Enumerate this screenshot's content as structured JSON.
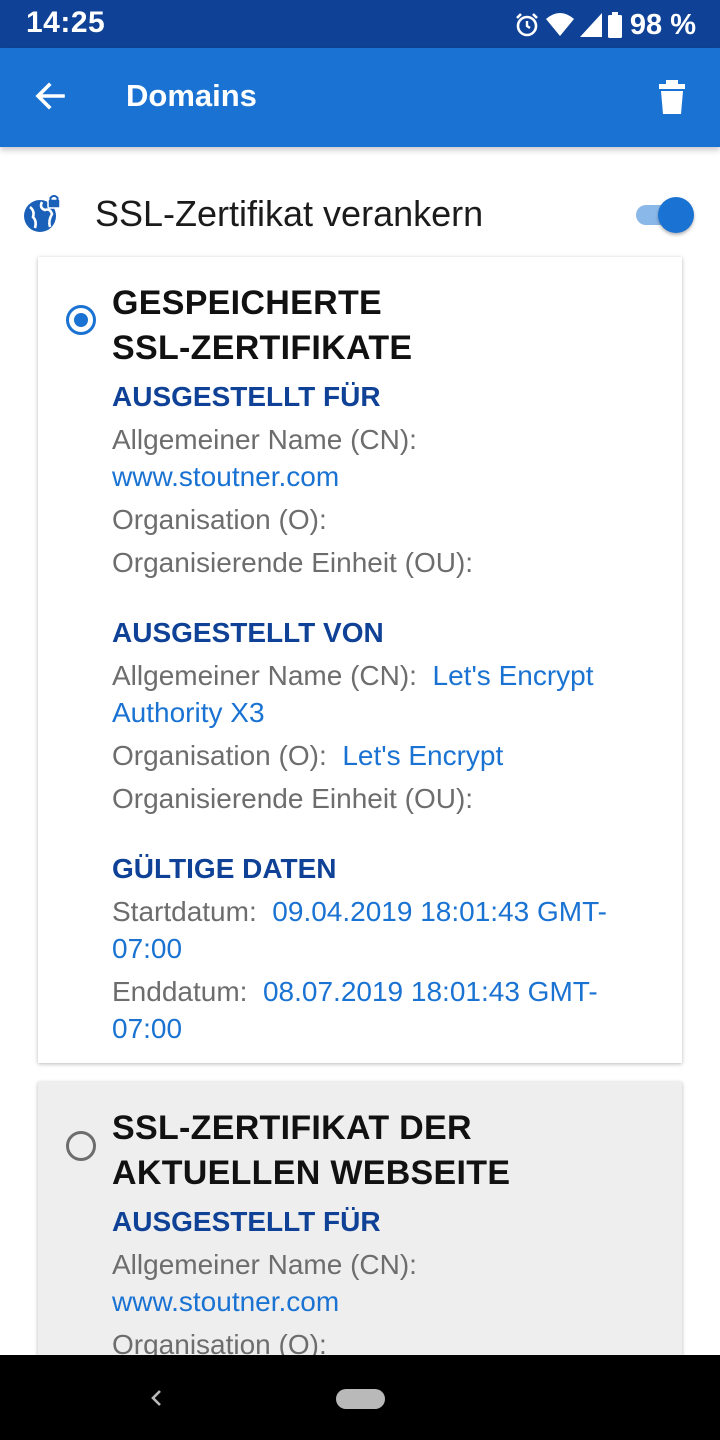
{
  "status_bar": {
    "time": "14:25",
    "battery": "98 %",
    "icons": [
      "alarm-icon",
      "wifi-icon",
      "cell-signal-icon",
      "battery-icon"
    ]
  },
  "app_bar": {
    "title": "Domains",
    "back_icon": "arrow-back-icon",
    "delete_icon": "trash-icon"
  },
  "pin": {
    "label": "SSL-Zertifikat verankern",
    "icon": "globe-lock-icon",
    "enabled": true
  },
  "stored_cert": {
    "selected": true,
    "title_line1": "GESPEICHERTE",
    "title_line2": "SSL-ZERTIFIKATE",
    "issued_to": {
      "heading": "AUSGESTELLT FÜR",
      "cn_label": "Allgemeiner Name (CN):",
      "cn_value": "www.stoutner.com",
      "o_label": "Organisation (O):",
      "o_value": "",
      "ou_label": "Organisierende Einheit (OU):",
      "ou_value": ""
    },
    "issued_by": {
      "heading": "AUSGESTELLT VON",
      "cn_label": "Allgemeiner Name (CN):",
      "cn_value": "Let's Encrypt Authority X3",
      "o_label": "Organisation (O):",
      "o_value": "Let's Encrypt",
      "ou_label": "Organisierende Einheit (OU):",
      "ou_value": ""
    },
    "valid": {
      "heading": "GÜLTIGE DATEN",
      "start_label": "Startdatum:",
      "start_value": "09.04.2019 18:01:43 GMT-07:00",
      "end_label": "Enddatum:",
      "end_value": "08.07.2019 18:01:43 GMT-07:00"
    }
  },
  "current_cert": {
    "selected": false,
    "title_line1": "SSL-ZERTIFIKAT DER",
    "title_line2": "AKTUELLEN WEBSEITE",
    "issued_to": {
      "heading": "AUSGESTELLT FÜR",
      "cn_label": "Allgemeiner Name (CN):",
      "cn_value": "www.stoutner.com",
      "o_label": "Organisation (O):"
    }
  },
  "colors": {
    "status_bar": "#0f4296",
    "app_bar": "#1a73d2",
    "accent": "#1a73d2",
    "heading_blue": "#0f4296",
    "label_gray": "#6d6d6d"
  }
}
